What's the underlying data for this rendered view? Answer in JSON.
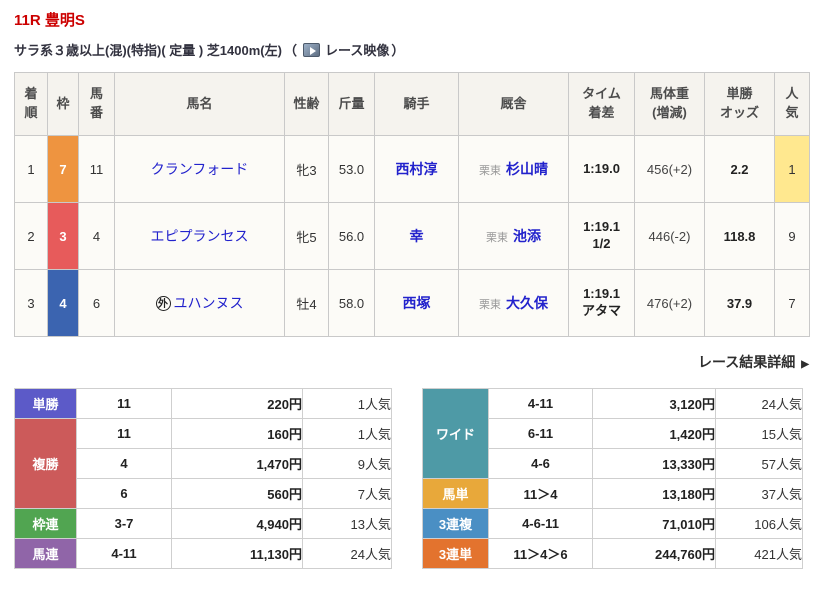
{
  "page": {
    "title": "11R 豊明S",
    "conditions": "サラ系３歳以上(混)(特指)( 定量 ) 芝1400m(左)",
    "video_open": "（",
    "video_label": "レース映像",
    "video_close": "）",
    "detail_link": "レース結果詳細",
    "detail_arrow": "▶"
  },
  "colors": {
    "title_red": "#cc0000",
    "link_blue": "#2222cc",
    "favorite_yellow": "#ffe88f"
  },
  "results": {
    "headers": [
      "着\n順",
      "枠",
      "馬\n番",
      "馬名",
      "性齢",
      "斤量",
      "騎手",
      "厩舎",
      "タイム\n着差",
      "馬体重\n(増減)",
      "単勝\nオッズ",
      "人\n気"
    ],
    "rows": [
      {
        "rank": "1",
        "waku": "7",
        "waku_color": "#ee9440",
        "umaban": "11",
        "horse_mark": "",
        "horse": "クランフォード",
        "sexage": "牝3",
        "weight": "53.0",
        "jockey": "西村淳",
        "region": "栗東",
        "trainer": "杉山晴",
        "time_full": "1:19.0",
        "horse_weight": "456(+2)",
        "odds": "2.2",
        "ninki": "1",
        "ninki_bg": "#ffe88f"
      },
      {
        "rank": "2",
        "waku": "3",
        "waku_color": "#e75b5b",
        "umaban": "4",
        "horse_mark": "",
        "horse": "エピプランセス",
        "sexage": "牝5",
        "weight": "56.0",
        "jockey": "幸",
        "region": "栗東",
        "trainer": "池添",
        "time_full": "1:19.1\n1/2",
        "horse_weight": "446(-2)",
        "odds": "118.8",
        "ninki": "9"
      },
      {
        "rank": "3",
        "waku": "4",
        "waku_color": "#3b64b0",
        "umaban": "6",
        "horse_mark": "外",
        "horse": "ユハンヌス",
        "sexage": "牡4",
        "weight": "58.0",
        "jockey": "西塚",
        "region": "栗東",
        "trainer": "大久保",
        "time_full": "1:19.1\nアタマ",
        "horse_weight": "476(+2)",
        "odds": "37.9",
        "ninki": "7"
      }
    ]
  },
  "payouts": {
    "left": [
      {
        "label": "単勝",
        "color": "#5c5ac8",
        "rows": [
          {
            "combo": "11",
            "amount": "220円",
            "ninki": "1人気"
          }
        ]
      },
      {
        "label": "複勝",
        "color": "#cc5a5a",
        "rows": [
          {
            "combo": "11",
            "amount": "160円",
            "ninki": "1人気"
          },
          {
            "combo": "4",
            "amount": "1,470円",
            "ninki": "9人気"
          },
          {
            "combo": "6",
            "amount": "560円",
            "ninki": "7人気"
          }
        ]
      },
      {
        "label": "枠連",
        "color": "#51a551",
        "rows": [
          {
            "combo": "3-7",
            "amount": "4,940円",
            "ninki": "13人気"
          }
        ]
      },
      {
        "label": "馬連",
        "color": "#9065a8",
        "rows": [
          {
            "combo": "4-11",
            "amount": "11,130円",
            "ninki": "24人気"
          }
        ]
      }
    ],
    "right": [
      {
        "label": "ワイド",
        "color": "#4e9aa6",
        "rows": [
          {
            "combo": "4-11",
            "amount": "3,120円",
            "ninki": "24人気"
          },
          {
            "combo": "6-11",
            "amount": "1,420円",
            "ninki": "15人気"
          },
          {
            "combo": "4-6",
            "amount": "13,330円",
            "ninki": "57人気"
          }
        ]
      },
      {
        "label": "馬単",
        "color": "#e8a83a",
        "rows": [
          {
            "combo": "11＞4",
            "amount": "13,180円",
            "ninki": "37人気"
          }
        ]
      },
      {
        "label": "3連複",
        "color": "#4a8fc4",
        "rows": [
          {
            "combo": "4-6-11",
            "amount": "71,010円",
            "ninki": "106人気"
          }
        ]
      },
      {
        "label": "3連単",
        "color": "#e3732e",
        "rows": [
          {
            "combo": "11＞4＞6",
            "amount": "244,760円",
            "ninki": "421人気"
          }
        ]
      }
    ]
  }
}
